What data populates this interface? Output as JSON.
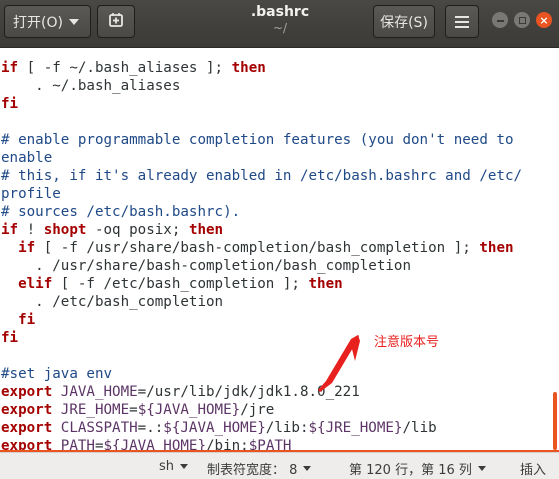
{
  "header": {
    "open_label": "打开(O)",
    "title": ".bashrc",
    "subtitle": "~/",
    "save_label": "保存(S)"
  },
  "icons": {
    "pin": "pin-icon",
    "menu": "hamburger-icon",
    "minimize": "minimize-icon",
    "maximize": "maximize-icon",
    "close": "close-icon"
  },
  "colors": {
    "accent": "#e95420",
    "keyword": "#a40000",
    "comment": "#204a87",
    "variable": "#5c3566",
    "annotation": "#e8201e"
  },
  "editor": {
    "lines": [
      [
        {
          "t": "if",
          "c": "kw"
        },
        {
          "t": " [ -f ~/.bash_aliases ]; "
        },
        {
          "t": "then",
          "c": "kw"
        }
      ],
      [
        {
          "t": "    . ~/.bash_aliases"
        }
      ],
      [
        {
          "t": "fi",
          "c": "kw"
        }
      ],
      [
        {
          "t": ""
        }
      ],
      [
        {
          "t": "# enable programmable completion features (you don't need to",
          "c": "cm"
        }
      ],
      [
        {
          "t": "enable",
          "c": "cm"
        }
      ],
      [
        {
          "t": "# this, if it's already enabled in /etc/bash.bashrc and /etc/",
          "c": "cm"
        }
      ],
      [
        {
          "t": "profile",
          "c": "cm"
        }
      ],
      [
        {
          "t": "# sources /etc/bash.bashrc).",
          "c": "cm"
        }
      ],
      [
        {
          "t": "if",
          "c": "kw"
        },
        {
          "t": " ! "
        },
        {
          "t": "shopt",
          "c": "kw"
        },
        {
          "t": " -oq posix; "
        },
        {
          "t": "then",
          "c": "kw"
        }
      ],
      [
        {
          "t": "  "
        },
        {
          "t": "if",
          "c": "kw"
        },
        {
          "t": " [ -f /usr/share/bash-completion/bash_completion ]; "
        },
        {
          "t": "then",
          "c": "kw"
        }
      ],
      [
        {
          "t": "    . /usr/share/bash-completion/bash_completion"
        }
      ],
      [
        {
          "t": "  "
        },
        {
          "t": "elif",
          "c": "kw"
        },
        {
          "t": " [ -f /etc/bash_completion ]; "
        },
        {
          "t": "then",
          "c": "kw"
        }
      ],
      [
        {
          "t": "    . /etc/bash_completion"
        }
      ],
      [
        {
          "t": "  "
        },
        {
          "t": "fi",
          "c": "kw"
        }
      ],
      [
        {
          "t": "fi",
          "c": "kw"
        }
      ],
      [
        {
          "t": ""
        }
      ],
      [
        {
          "t": "#set java env",
          "c": "cm"
        }
      ],
      [
        {
          "t": "export",
          "c": "kw"
        },
        {
          "t": " "
        },
        {
          "t": "JAVA_HOME",
          "c": "vr"
        },
        {
          "t": "=/usr/lib/jdk/jdk1.8.0_221"
        }
      ],
      [
        {
          "t": "export",
          "c": "kw"
        },
        {
          "t": " "
        },
        {
          "t": "JRE_HOME",
          "c": "vr"
        },
        {
          "t": "="
        },
        {
          "t": "${JAVA_HOME}",
          "c": "vr"
        },
        {
          "t": "/jre"
        }
      ],
      [
        {
          "t": "export",
          "c": "kw"
        },
        {
          "t": " "
        },
        {
          "t": "CLASSPATH",
          "c": "vr"
        },
        {
          "t": "=.:"
        },
        {
          "t": "${JAVA_HOME}",
          "c": "vr"
        },
        {
          "t": "/lib:"
        },
        {
          "t": "${JRE_HOME}",
          "c": "vr"
        },
        {
          "t": "/lib"
        }
      ],
      [
        {
          "t": "export",
          "c": "kw"
        },
        {
          "t": " "
        },
        {
          "t": "PATH",
          "c": "vr"
        },
        {
          "t": "="
        },
        {
          "t": "${JAVA_HOME}",
          "c": "vr"
        },
        {
          "t": "/bin:"
        },
        {
          "t": "$PATH",
          "c": "vr"
        }
      ]
    ]
  },
  "annotation": {
    "text": "注意版本号"
  },
  "statusbar": {
    "language": "sh",
    "tab_width": "制表符宽度： 8",
    "cursor": "第 120 行，第 16 列",
    "mode": "插入"
  }
}
